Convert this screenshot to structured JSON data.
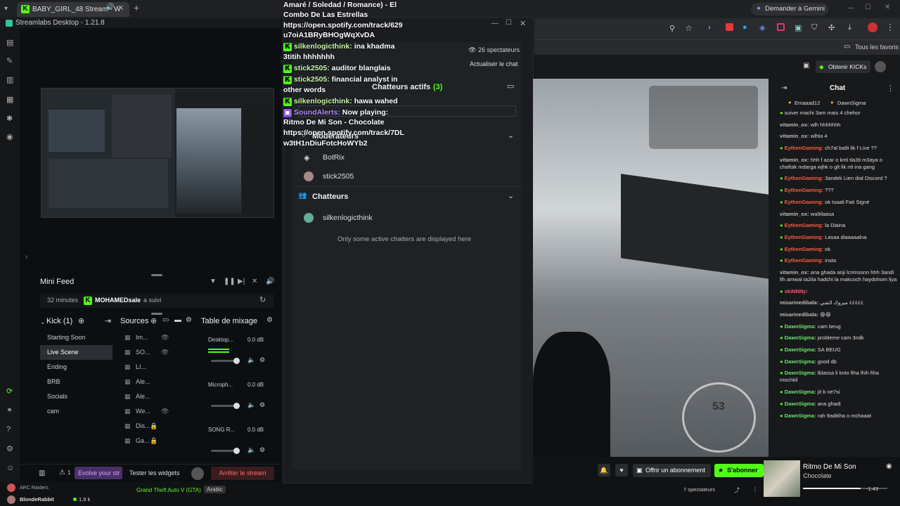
{
  "browser": {
    "tab_title": "BABY_GIRL_48 Stream - W",
    "gemini_label": "Demander à Gemini",
    "bookmarks_label": "Tous les favoris"
  },
  "streamlabs": {
    "title": "Streamlabs Desktop - 1.21.8",
    "mini_feed": {
      "title": "Mini Feed",
      "event_time": "32 minutes",
      "event_user": "MOHAMEDsale",
      "event_action": "a suivi"
    },
    "scenes": {
      "title": "Kick (1)",
      "items": [
        "Starting Soon",
        "Live Scene",
        "Ending",
        "BRB",
        "Socials",
        "cam"
      ]
    },
    "sources": {
      "title": "Sources",
      "items": [
        "Im...",
        "SO...",
        "LI...",
        "Ale...",
        "Ale...",
        "We...",
        "Dis...",
        "Ga..."
      ]
    },
    "mixer": {
      "title": "Table de mixage",
      "channels": [
        {
          "name": "Desktop...",
          "db": "0.0 dB",
          "level": 0.9
        },
        {
          "name": "Microph...",
          "db": "0.0 dB",
          "level": 0.9
        },
        {
          "name": "SONG R...",
          "db": "0.0 dB",
          "level": 0.9
        }
      ]
    },
    "bottom": {
      "count": "1",
      "evolve": "Evolve your str",
      "test_widgets": "Tester les widgets",
      "stop_stream": "Arrêter le stream"
    }
  },
  "chat_popup": {
    "spectators": "26 spectateurs",
    "refresh": "Actualiser le chat",
    "active_chatters_label": "Chatteurs actifs",
    "active_chatters_count": "(3)",
    "moderators_label": "Modérateurs",
    "moderators": [
      "BotRix",
      "stick2505"
    ],
    "chatters_label": "Chatteurs",
    "chatters": [
      "silkenlogicthink"
    ],
    "note": "Only some active chatters are displayed here",
    "overlay_lines": [
      {
        "user": "",
        "text": "Amaré / Soledad / Romance) - El"
      },
      {
        "user": "",
        "text": "Combo De Las Estrellas"
      },
      {
        "user": "",
        "text": "https://open.spotify.com/track/629"
      },
      {
        "user": "",
        "text": "u7oiA1BRyBHOgWqXvDA"
      },
      {
        "user": "silkenlogicthink:",
        "text": "ina khadma"
      },
      {
        "user": "",
        "text": "3titih hhhhhhh"
      },
      {
        "user": "stick2505:",
        "text": "auditor blanglais"
      },
      {
        "user": "stick2505:",
        "text": "financial analyst in"
      },
      {
        "user": "",
        "text": "other words"
      },
      {
        "user": "silkenlogicthink:",
        "text": "hawa wahed"
      },
      {
        "user": "SoundAlerts:",
        "text": "Now playing:"
      },
      {
        "user": "",
        "text": "Ritmo De Mi Son - Chocolate"
      },
      {
        "user": "",
        "text": "https://open.spotify.com/track/7DL"
      },
      {
        "user": "",
        "text": "w3tH1nDiuFotcHoWYb2"
      }
    ]
  },
  "stream": {
    "kick_button": "Obtenir KICKs",
    "chat_title": "Chat",
    "top_users": [
      "Emaaad12",
      "DawnSigma"
    ],
    "speed": "53",
    "subscribe_offer": "Offrir un abonnement",
    "subscribe": "S'abonner",
    "song_title": "Ritmo De Mi Son",
    "song_artist": "Chocolate",
    "song_time": "-1:43",
    "viewers": "7 spectateurs",
    "game": "Grand Theft Auto V (GTA)",
    "language": "Arabic",
    "left_channel_1": "ARC Raiders",
    "left_channel_2": "BlondeRabbit",
    "left_channel_2_viewers": "1,9 k",
    "chat": [
      {
        "user": "",
        "text": "suiver machi 3am mais 4 chehor",
        "color": "#dddddd"
      },
      {
        "user": "vitamin_ox:",
        "text": "wlh hhhhhhh",
        "color": "#bbbbbb"
      },
      {
        "user": "vitamin_ox:",
        "text": "wlhta 4",
        "color": "#bbbbbb"
      },
      {
        "user": "EythenGaming:",
        "text": "ch7al ba9i lik f Live ??",
        "color": "#ff5a3c"
      },
      {
        "user": "vitamin_ox:",
        "text": "hhh f azar o knti tla3ti m3aya o chaftak mdarga wjhk o glt lik nti ina gang",
        "color": "#bbbbbb"
      },
      {
        "user": "EythenGaming:",
        "text": "3andek Lien dial Discord ?",
        "color": "#ff5a3c"
      },
      {
        "user": "EythenGaming:",
        "text": "???",
        "color": "#ff5a3c"
      },
      {
        "user": "EythenGaming:",
        "text": "ok tsaali Fait Signé",
        "color": "#ff5a3c"
      },
      {
        "user": "vitamin_ox:",
        "text": "wa9ilaasa",
        "color": "#bbbbbb"
      },
      {
        "user": "EythenGaming:",
        "text": "la Diaina",
        "color": "#ff5a3c"
      },
      {
        "user": "EythenGaming:",
        "text": "Lasaa diaaaaalna",
        "color": "#ff5a3c"
      },
      {
        "user": "EythenGaming:",
        "text": "ok",
        "color": "#ff5a3c"
      },
      {
        "user": "EythenGaming:",
        "text": "insta",
        "color": "#ff5a3c"
      },
      {
        "user": "vitamin_ox:",
        "text": "ana ghada anji lcrimsonn hhh 3andi fih amwal ta2ila hadchi la makcoch haydohom liya",
        "color": "#bbbbbb"
      },
      {
        "user": "skiNNNy:",
        "text": "",
        "color": "#ff5577"
      },
      {
        "user": "misarinedibala:",
        "text": "٤٤٤٤٤ مبروك الشي",
        "color": "#bbbbbb"
      },
      {
        "user": "misarinedibala:",
        "text": "😆😆",
        "color": "#bbbbbb"
      },
      {
        "user": "DawnSigma:",
        "text": "cam beug",
        "color": "#6ee06e"
      },
      {
        "user": "DawnSigma:",
        "text": "probleme cam 3ndk",
        "color": "#6ee06e"
      },
      {
        "user": "DawnSigma:",
        "text": "SA BEUG",
        "color": "#6ee06e"
      },
      {
        "user": "DawnSigma:",
        "text": "good db",
        "color": "#6ee06e"
      },
      {
        "user": "DawnSigma:",
        "text": "lblassa li knto fiha lhih fiha mochkil",
        "color": "#6ee06e"
      },
      {
        "user": "DawnSigma:",
        "text": "jit b ne7si",
        "color": "#6ee06e"
      },
      {
        "user": "DawnSigma:",
        "text": "ana ghadi",
        "color": "#6ee06e"
      },
      {
        "user": "DawnSigma:",
        "text": "rah 9aditiha o mchaaat",
        "color": "#6ee06e"
      }
    ]
  },
  "colors": {
    "kick_green": "#53fc18",
    "stop_red": "#e04a4a",
    "evolve_purple": "#4b2f6b"
  }
}
